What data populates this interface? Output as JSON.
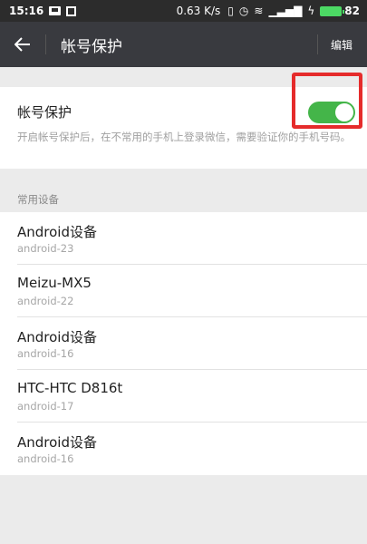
{
  "status_bar": {
    "time": "15:16",
    "speed": "0.63 K/s",
    "battery": "82"
  },
  "titlebar": {
    "title": "帐号保护",
    "edit_label": "编辑"
  },
  "protect": {
    "label": "帐号保护",
    "description": "开启帐号保护后，在不常用的手机上登录微信，需要验证你的手机号码。",
    "enabled": true
  },
  "devices_section": {
    "header": "常用设备",
    "items": [
      {
        "name": "Android设备",
        "os": "android-23"
      },
      {
        "name": "Meizu-MX5",
        "os": "android-22"
      },
      {
        "name": "Android设备",
        "os": "android-16"
      },
      {
        "name": "HTC-HTC D816t",
        "os": "android-17"
      },
      {
        "name": "Android设备",
        "os": "android-16"
      }
    ]
  },
  "colors": {
    "toggle_on": "#44b549",
    "titlebar_bg": "#393a3f",
    "annotation": "#e52b2b"
  }
}
